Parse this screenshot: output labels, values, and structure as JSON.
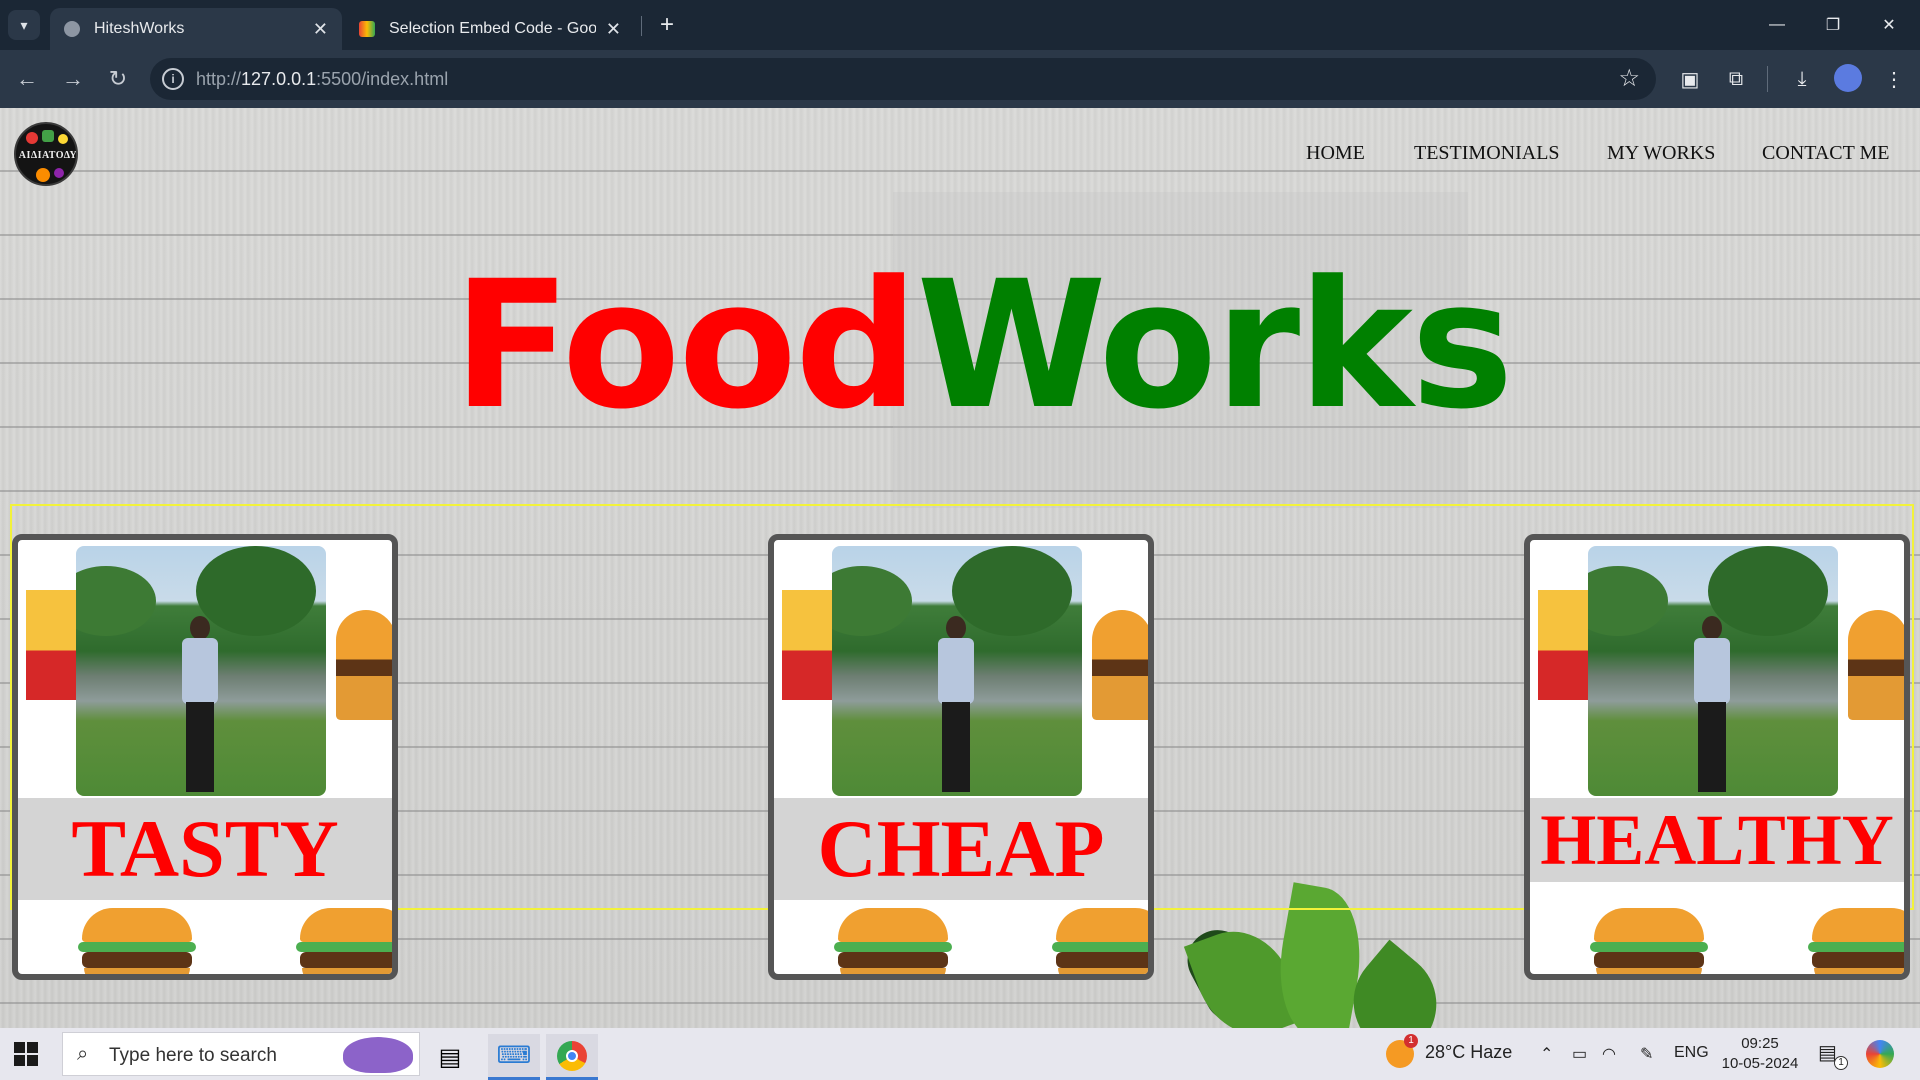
{
  "browser": {
    "tabs": [
      {
        "title": "HiteshWorks",
        "active": true
      },
      {
        "title": "Selection Embed Code - Google",
        "active": false
      }
    ],
    "url_prefix": "http://",
    "url_host": "127.0.0.1",
    "url_rest": ":5500/index.html"
  },
  "site": {
    "logo_text": "ΑΙΔΙΑΤΟΔΥ",
    "nav": [
      "HOME",
      "TESTIMONIALS",
      "MY WORKS",
      "CONTACT ME"
    ],
    "hero_food": "Food",
    "hero_works": "Works",
    "cards": [
      {
        "label": "TASTY"
      },
      {
        "label": "CHEAP"
      },
      {
        "label": "HEALTHY"
      }
    ]
  },
  "taskbar": {
    "search_placeholder": "Type here to search",
    "weather_badge": "1",
    "weather": "28°C  Haze",
    "lang": "ENG",
    "time": "09:25",
    "date": "10-05-2024",
    "notification_count": "1"
  },
  "colors": {
    "hero_red": "#ff0000",
    "hero_green": "#008000",
    "card_label": "#ff0000",
    "card_frame_border": "#f2f23a"
  }
}
